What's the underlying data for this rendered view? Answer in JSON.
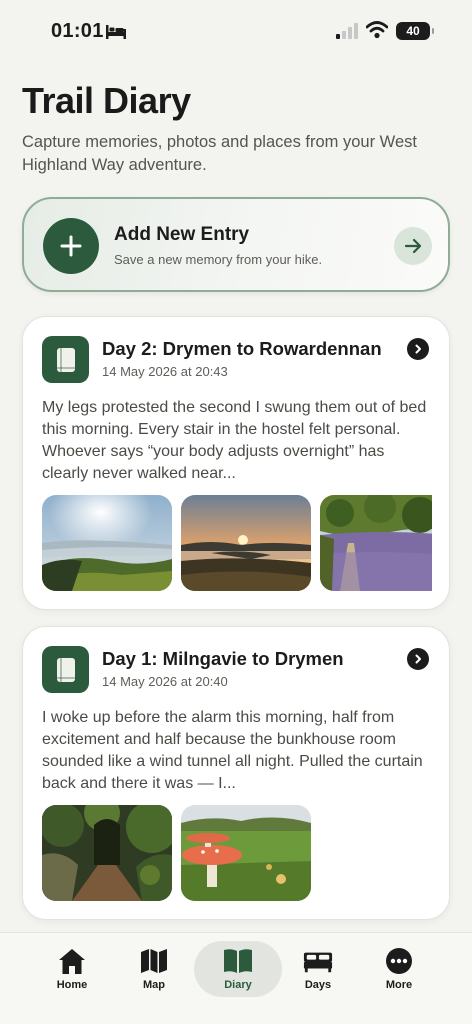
{
  "status_bar": {
    "time": "01:01",
    "battery": "40"
  },
  "header": {
    "title": "Trail Diary",
    "subtitle": "Capture memories, photos and places from your West Highland Way adventure."
  },
  "add_entry": {
    "title": "Add New Entry",
    "subtitle": "Save a new memory from your hike."
  },
  "entries": [
    {
      "title": "Day 2: Drymen to Rowardennan",
      "date": "14 May 2026 at 20:43",
      "excerpt": "My legs protested the second I swung them out of bed this morning. Every stair in the hostel felt personal. Whoever says “your body adjusts overnight” has clearly never walked near...",
      "photos": [
        "hillside-loch-photo",
        "sunset-loch-photo",
        "bluebell-path-photo"
      ]
    },
    {
      "title": "Day 1: Milngavie to Drymen",
      "date": "14 May 2026 at 20:40",
      "excerpt": "I woke up before the alarm this morning, half from excitement and half because the bunkhouse room sounded like a wind tunnel all night. Pulled the curtain back and there it was — I...",
      "photos": [
        "woodland-tunnel-photo",
        "toadstool-field-photo"
      ]
    }
  ],
  "tabs": [
    {
      "label": "Home",
      "icon": "house-icon"
    },
    {
      "label": "Map",
      "icon": "map-icon"
    },
    {
      "label": "Diary",
      "icon": "book-icon",
      "active": true
    },
    {
      "label": "Days",
      "icon": "bed-icon"
    },
    {
      "label": "More",
      "icon": "ellipsis-icon"
    }
  ],
  "colors": {
    "accent": "#2b5a3c",
    "background": "#f3f3ef",
    "card": "#ffffff"
  }
}
